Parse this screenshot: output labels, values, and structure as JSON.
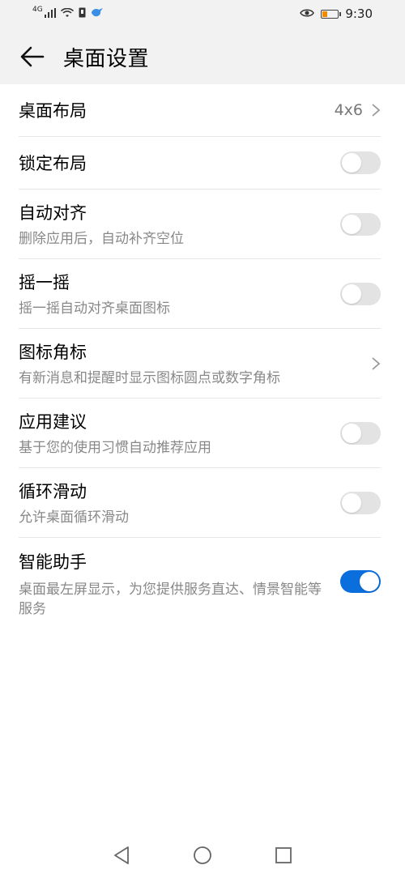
{
  "status_bar": {
    "network_label": "4G",
    "time": "9:30"
  },
  "header": {
    "title": "桌面设置"
  },
  "settings": [
    {
      "label": "桌面布局",
      "value": "4x6"
    },
    {
      "label": "锁定布局",
      "enabled": false
    },
    {
      "label": "自动对齐",
      "sub": "删除应用后，自动补齐空位",
      "enabled": false
    },
    {
      "label": "摇一摇",
      "sub": "摇一摇自动对齐桌面图标",
      "enabled": false
    },
    {
      "label": "图标角标",
      "sub": "有新消息和提醒时显示图标圆点或数字角标"
    },
    {
      "label": "应用建议",
      "sub": "基于您的使用习惯自动推荐应用",
      "enabled": false
    },
    {
      "label": "循环滑动",
      "sub": "允许桌面循环滑动",
      "enabled": false
    },
    {
      "label": "智能助手",
      "sub": "桌面最左屏显示，为您提供服务直达、情景智能等服务",
      "enabled": true
    }
  ],
  "colors": {
    "accent": "#0a6edc",
    "toggle_off": "#e3e3e3",
    "header_bg": "#f2f2f2"
  },
  "icons": [
    "back-arrow-icon",
    "chevron-right-icon",
    "nav-back-icon",
    "nav-home-icon",
    "nav-recents-icon"
  ]
}
